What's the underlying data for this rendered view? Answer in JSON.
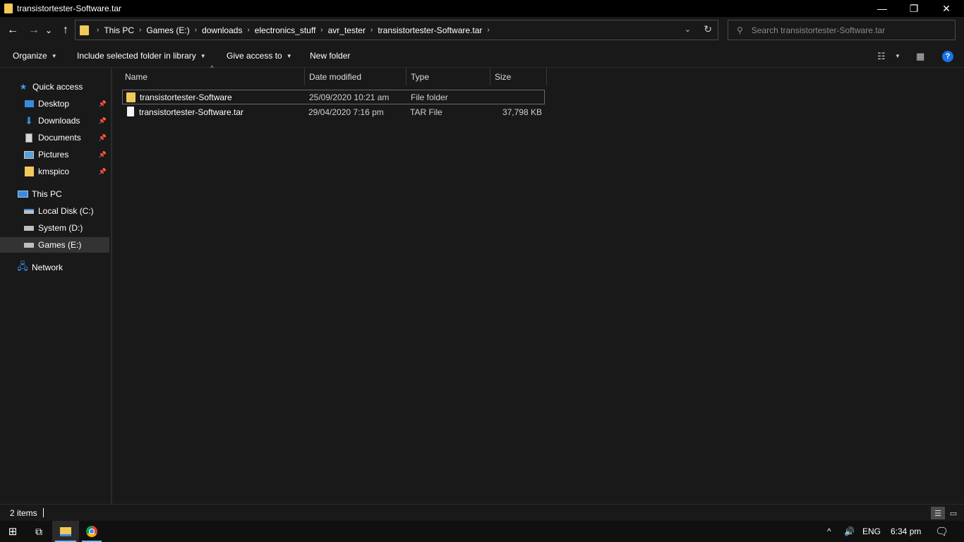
{
  "window": {
    "title": "transistortester-Software.tar",
    "min_glyph": "—",
    "restore_glyph": "❐",
    "close_glyph": "✕"
  },
  "nav": {
    "back_glyph": "←",
    "forward_glyph": "→",
    "recent_glyph": "⌄",
    "up_glyph": "↑"
  },
  "address": {
    "crumbs": [
      "This PC",
      "Games (E:)",
      "downloads",
      "electronics_stuff",
      "avr_tester",
      "transistortester-Software.tar"
    ],
    "separator": "›",
    "dropdown_glyph": "⌄",
    "refresh_glyph": "↻"
  },
  "search": {
    "placeholder": "Search transistortester-Software.tar",
    "value": ""
  },
  "commandbar": {
    "organize": "Organize",
    "include_library": "Include selected folder in library",
    "give_access": "Give access to",
    "new_folder": "New folder",
    "dropdown_glyph": "▼",
    "help_glyph": "?"
  },
  "navpane": {
    "quick_access": "Quick access",
    "quick_items": [
      {
        "label": "Desktop",
        "icon": "desktop-icon",
        "pinned": true
      },
      {
        "label": "Downloads",
        "icon": "downloads-icon",
        "pinned": true
      },
      {
        "label": "Documents",
        "icon": "documents-icon",
        "pinned": true
      },
      {
        "label": "Pictures",
        "icon": "pictures-icon",
        "pinned": true
      },
      {
        "label": "kmspico",
        "icon": "folder-icon",
        "pinned": true
      }
    ],
    "this_pc": "This PC",
    "drives": [
      {
        "label": "Local Disk (C:)",
        "icon": "local-disk-icon",
        "selected": false
      },
      {
        "label": "System (D:)",
        "icon": "drive-icon",
        "selected": false
      },
      {
        "label": "Games (E:)",
        "icon": "drive-icon",
        "selected": true
      }
    ],
    "network": "Network"
  },
  "filelist": {
    "columns": {
      "name": "Name",
      "date": "Date modified",
      "type": "Type",
      "size": "Size"
    },
    "sort_glyph": "^",
    "rows": [
      {
        "name": "transistortester-Software",
        "date": "25/09/2020 10:21 am",
        "type": "File folder",
        "size": "",
        "icon": "folder-icon"
      },
      {
        "name": "transistortester-Software.tar",
        "date": "29/04/2020 7:16 pm",
        "type": "TAR File",
        "size": "37,798 KB",
        "icon": "file-icon"
      }
    ]
  },
  "status": {
    "count": "2 items"
  },
  "taskbar": {
    "language": "ENG",
    "time": "6:34 pm"
  },
  "colors": {
    "background": "#191919",
    "folder": "#f1c85a",
    "accent": "#1a73e8",
    "taskbar_active_underline": "#76b9ed"
  }
}
